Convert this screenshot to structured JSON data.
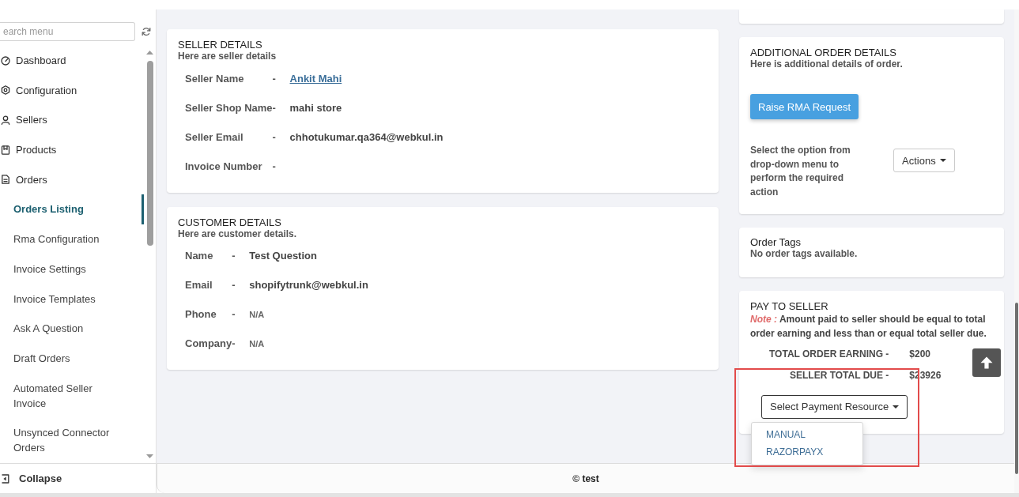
{
  "sidebar": {
    "search": {
      "placeholder": "earch menu"
    },
    "items": [
      {
        "label": "Dashboard",
        "selected": false
      },
      {
        "label": "Configuration",
        "selected": false
      },
      {
        "label": "Sellers",
        "selected": false
      },
      {
        "label": "Products",
        "selected": false
      },
      {
        "label": "Orders",
        "selected": false,
        "children": [
          {
            "label": "Orders Listing",
            "selected": true
          },
          {
            "label": "Rma Configuration",
            "selected": false
          },
          {
            "label": "Invoice Settings",
            "selected": false
          },
          {
            "label": "Invoice Templates",
            "selected": false
          },
          {
            "label": "Ask A Question",
            "selected": false
          },
          {
            "label": "Draft Orders",
            "selected": false
          },
          {
            "label": "Automated Seller Invoice",
            "selected": false
          },
          {
            "label": "Unsynced Connector Orders",
            "selected": false
          }
        ]
      }
    ],
    "collapse": {
      "label": "Collapse"
    }
  },
  "seller_details": {
    "title": "SELLER DETAILS",
    "subtitle": "Here are seller details",
    "rows": [
      {
        "label": "Seller Name",
        "separator": "-",
        "value": "Ankit Mahi",
        "kind": "link"
      },
      {
        "label": "Seller Shop Name",
        "separator": "-",
        "value": "mahi store",
        "kind": "text"
      },
      {
        "label": "Seller Email",
        "separator": "-",
        "value": "chhotukumar.qa364@webkul.in",
        "kind": "text"
      },
      {
        "label": "Invoice Number",
        "separator": "-"
      }
    ]
  },
  "customer_details": {
    "title": "CUSTOMER DETAILS",
    "subtitle": "Here are customer details.",
    "rows": [
      {
        "label": "Name",
        "separator": "-",
        "value": "Test Question",
        "kind": "text"
      },
      {
        "label": "Email",
        "separator": "-",
        "value": "shopifytrunk@webkul.in",
        "kind": "text"
      },
      {
        "label": "Phone",
        "separator": "-",
        "value": "N/A",
        "kind": "na"
      },
      {
        "label": "Company",
        "separator": "-",
        "value": "N/A",
        "kind": "na"
      }
    ]
  },
  "additional_order_details": {
    "title": "ADDITIONAL ORDER DETAILS",
    "subtitle": "Here is additional details of order.",
    "rma_button": "Raise RMA Request",
    "actions_text": "Select the option from drop-down menu to perform the required action",
    "actions_button": "Actions"
  },
  "order_tags": {
    "title": "Order Tags",
    "message": "No order tags available."
  },
  "pay_to_seller": {
    "title": "PAY TO SELLER",
    "note": "*Note :* Amount paid to seller should be equal to total order earning and less than or equal total seller due.",
    "totals": [
      {
        "label": "TOTAL ORDER EARNING -",
        "value": "$200"
      },
      {
        "label": "SELLER TOTAL DUE -",
        "value": "$23926"
      }
    ],
    "payment_menu": {
      "button": "Select Payment Resource",
      "open": true,
      "options": [
        {
          "label": "MANUAL",
          "selected": false
        },
        {
          "label": "RAZORPAYX",
          "selected": false
        }
      ]
    }
  },
  "footer": {
    "text": "© test"
  }
}
